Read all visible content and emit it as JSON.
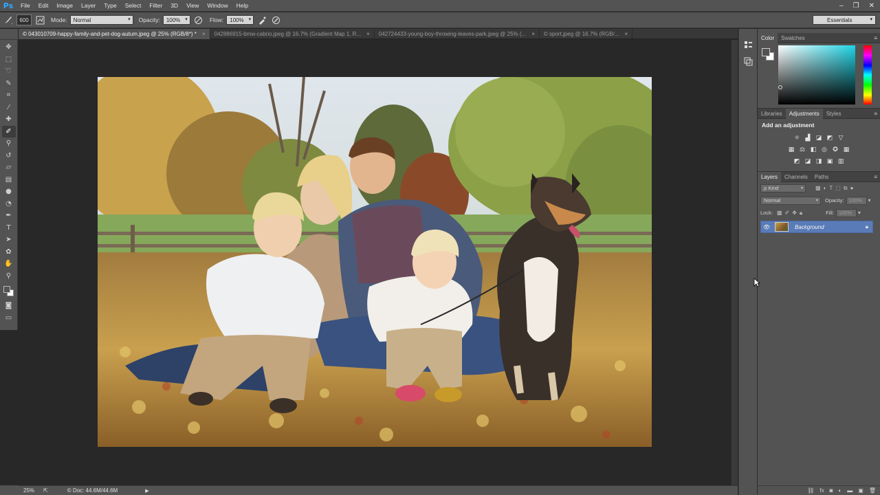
{
  "app": {
    "logo": "Ps"
  },
  "menu": [
    "File",
    "Edit",
    "Image",
    "Layer",
    "Type",
    "Select",
    "Filter",
    "3D",
    "View",
    "Window",
    "Help"
  ],
  "window_controls": {
    "minimize": "–",
    "restore": "❐",
    "close": "✕"
  },
  "options": {
    "brush_size": "600",
    "mode_label": "Mode:",
    "mode_value": "Normal",
    "opacity_label": "Opacity:",
    "opacity_value": "100%",
    "flow_label": "Flow:",
    "flow_value": "100%",
    "workspace": "Essentials"
  },
  "tabs": [
    {
      "label": "© 043010709-happy-family-and-pet-dog-autum.jpeg @ 25% (RGB/8*) *",
      "active": true
    },
    {
      "label": "042886915-bmw-cabrio.jpeg @ 16.7% (Gradient Map 1, R...",
      "active": false
    },
    {
      "label": "042724433-young-boy-throwing-leaves-park.jpeg @ 25% (...",
      "active": false
    },
    {
      "label": "© sport.jpeg @ 16.7% (RGB/...",
      "active": false
    }
  ],
  "tab_close": "×",
  "status": {
    "zoom": "25%",
    "doc": "© Doc: 44.6M/44.6M",
    "arrow": "▶"
  },
  "panels": {
    "color_tabs": [
      "Color",
      "Swatches"
    ],
    "adj_tabs": [
      "Libraries",
      "Adjustments",
      "Styles"
    ],
    "adj_title": "Add an adjustment",
    "layers_tabs": [
      "Layers",
      "Channels",
      "Paths"
    ],
    "kind": "ρ Kind",
    "blend": "Normal",
    "opacity_label": "Opacity:",
    "opacity_value": "100%",
    "lock_label": "Lock:",
    "fill_label": "Fill:",
    "fill_value": "100%",
    "layer_name": "Background"
  },
  "colors": {
    "accent_layer": "#597bb7",
    "color_field_hue": "#1fd4e6"
  }
}
